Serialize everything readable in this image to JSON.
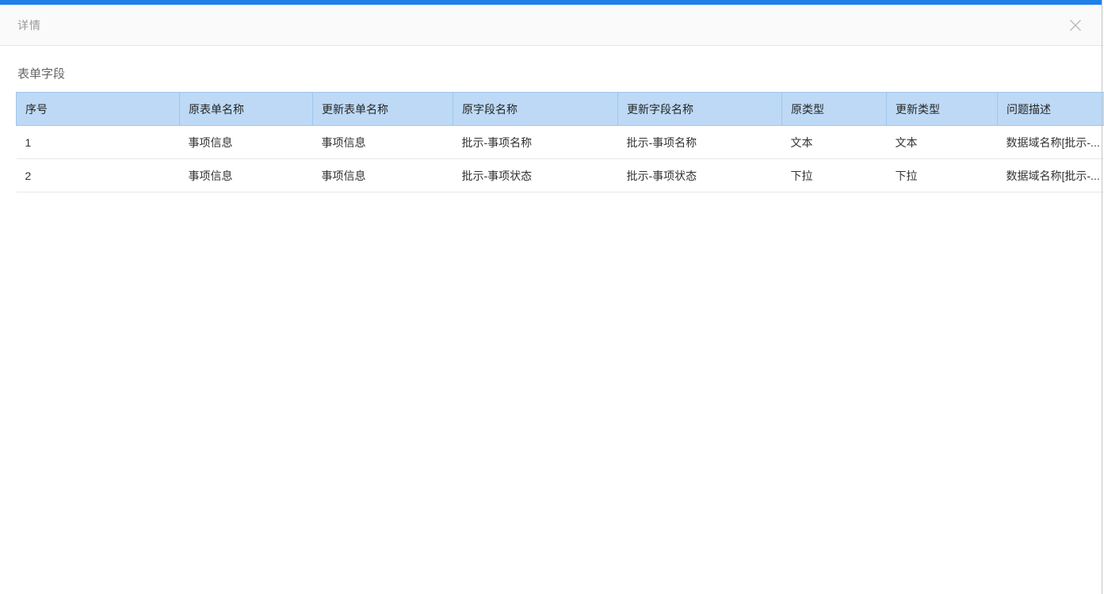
{
  "colors": {
    "top_accent_bar": "#1f80e8",
    "table_header_bg": "#bdd9f5",
    "table_header_border": "#9fc6ec",
    "row_divider": "#e8e8e8",
    "modal_header_bg": "#fafafa"
  },
  "modal": {
    "title": "详情",
    "close_icon": "close-icon"
  },
  "section": {
    "title": "表单字段"
  },
  "table": {
    "headers": [
      "序号",
      "原表单名称",
      "更新表单名称",
      "原字段名称",
      "更新字段名称",
      "原类型",
      "更新类型",
      "问题描述"
    ],
    "rows": [
      [
        "1",
        "事项信息",
        "事项信息",
        "批示-事项名称",
        "批示-事项名称",
        "文本",
        "文本",
        "数据域名称[批示-..."
      ],
      [
        "2",
        "事项信息",
        "事项信息",
        "批示-事项状态",
        "批示-事项状态",
        "下拉",
        "下拉",
        "数据域名称[批示-..."
      ]
    ]
  }
}
